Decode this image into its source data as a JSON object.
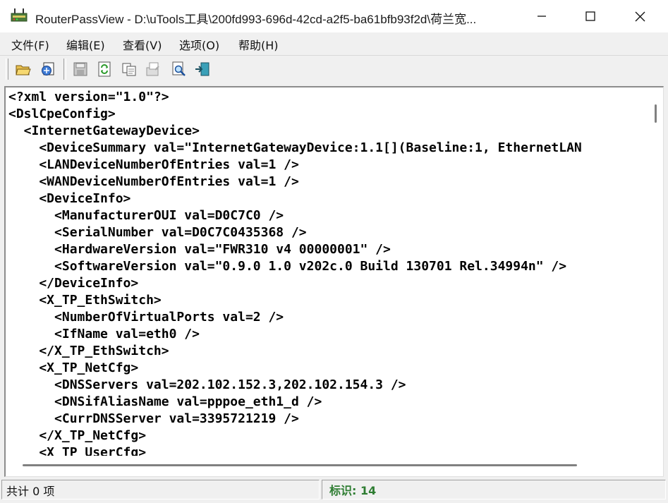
{
  "window": {
    "title": "RouterPassView  -  D:\\uTools工具\\200fd993-696d-42cd-a2f5-ba61bfb93f2d\\荷兰宽..."
  },
  "menu": {
    "items": [
      "文件(F)",
      "编辑(E)",
      "查看(V)",
      "选项(O)",
      "帮助(H)"
    ]
  },
  "toolbar": {
    "buttons": [
      "open-folder-icon",
      "open-config-icon",
      "save-icon",
      "refresh-icon",
      "copy-icon",
      "properties-icon",
      "find-icon",
      "exit-icon"
    ]
  },
  "editor": {
    "lines": [
      "<?xml version=\"1.0\"?>",
      "<DslCpeConfig>",
      "  <InternetGatewayDevice>",
      "    <DeviceSummary val=\"InternetGatewayDevice:1.1[](Baseline:1, EthernetLAN",
      "    <LANDeviceNumberOfEntries val=1 />",
      "    <WANDeviceNumberOfEntries val=1 />",
      "    <DeviceInfo>",
      "      <ManufacturerOUI val=D0C7C0 />",
      "      <SerialNumber val=D0C7C0435368 />",
      "      <HardwareVersion val=\"FWR310 v4 00000001\" />",
      "      <SoftwareVersion val=\"0.9.0 1.0 v202c.0 Build 130701 Rel.34994n\" />",
      "    </DeviceInfo>",
      "    <X_TP_EthSwitch>",
      "      <NumberOfVirtualPorts val=2 />",
      "      <IfName val=eth0 />",
      "    </X_TP_EthSwitch>",
      "    <X_TP_NetCfg>",
      "      <DNSServers val=202.102.152.3,202.102.154.3 />",
      "      <DNSifAliasName val=pppoe_eth1_d />",
      "      <CurrDNSServer val=3395721219 />",
      "    </X_TP_NetCfg>",
      "    <X_TP_UserCfg>"
    ]
  },
  "status": {
    "count": "共计 0 项",
    "tag": "标识: 14"
  },
  "colors": {
    "status_tag": "#2e7d32",
    "editor_bg": "#ffffff",
    "chrome_bg": "#f0f0f0"
  }
}
